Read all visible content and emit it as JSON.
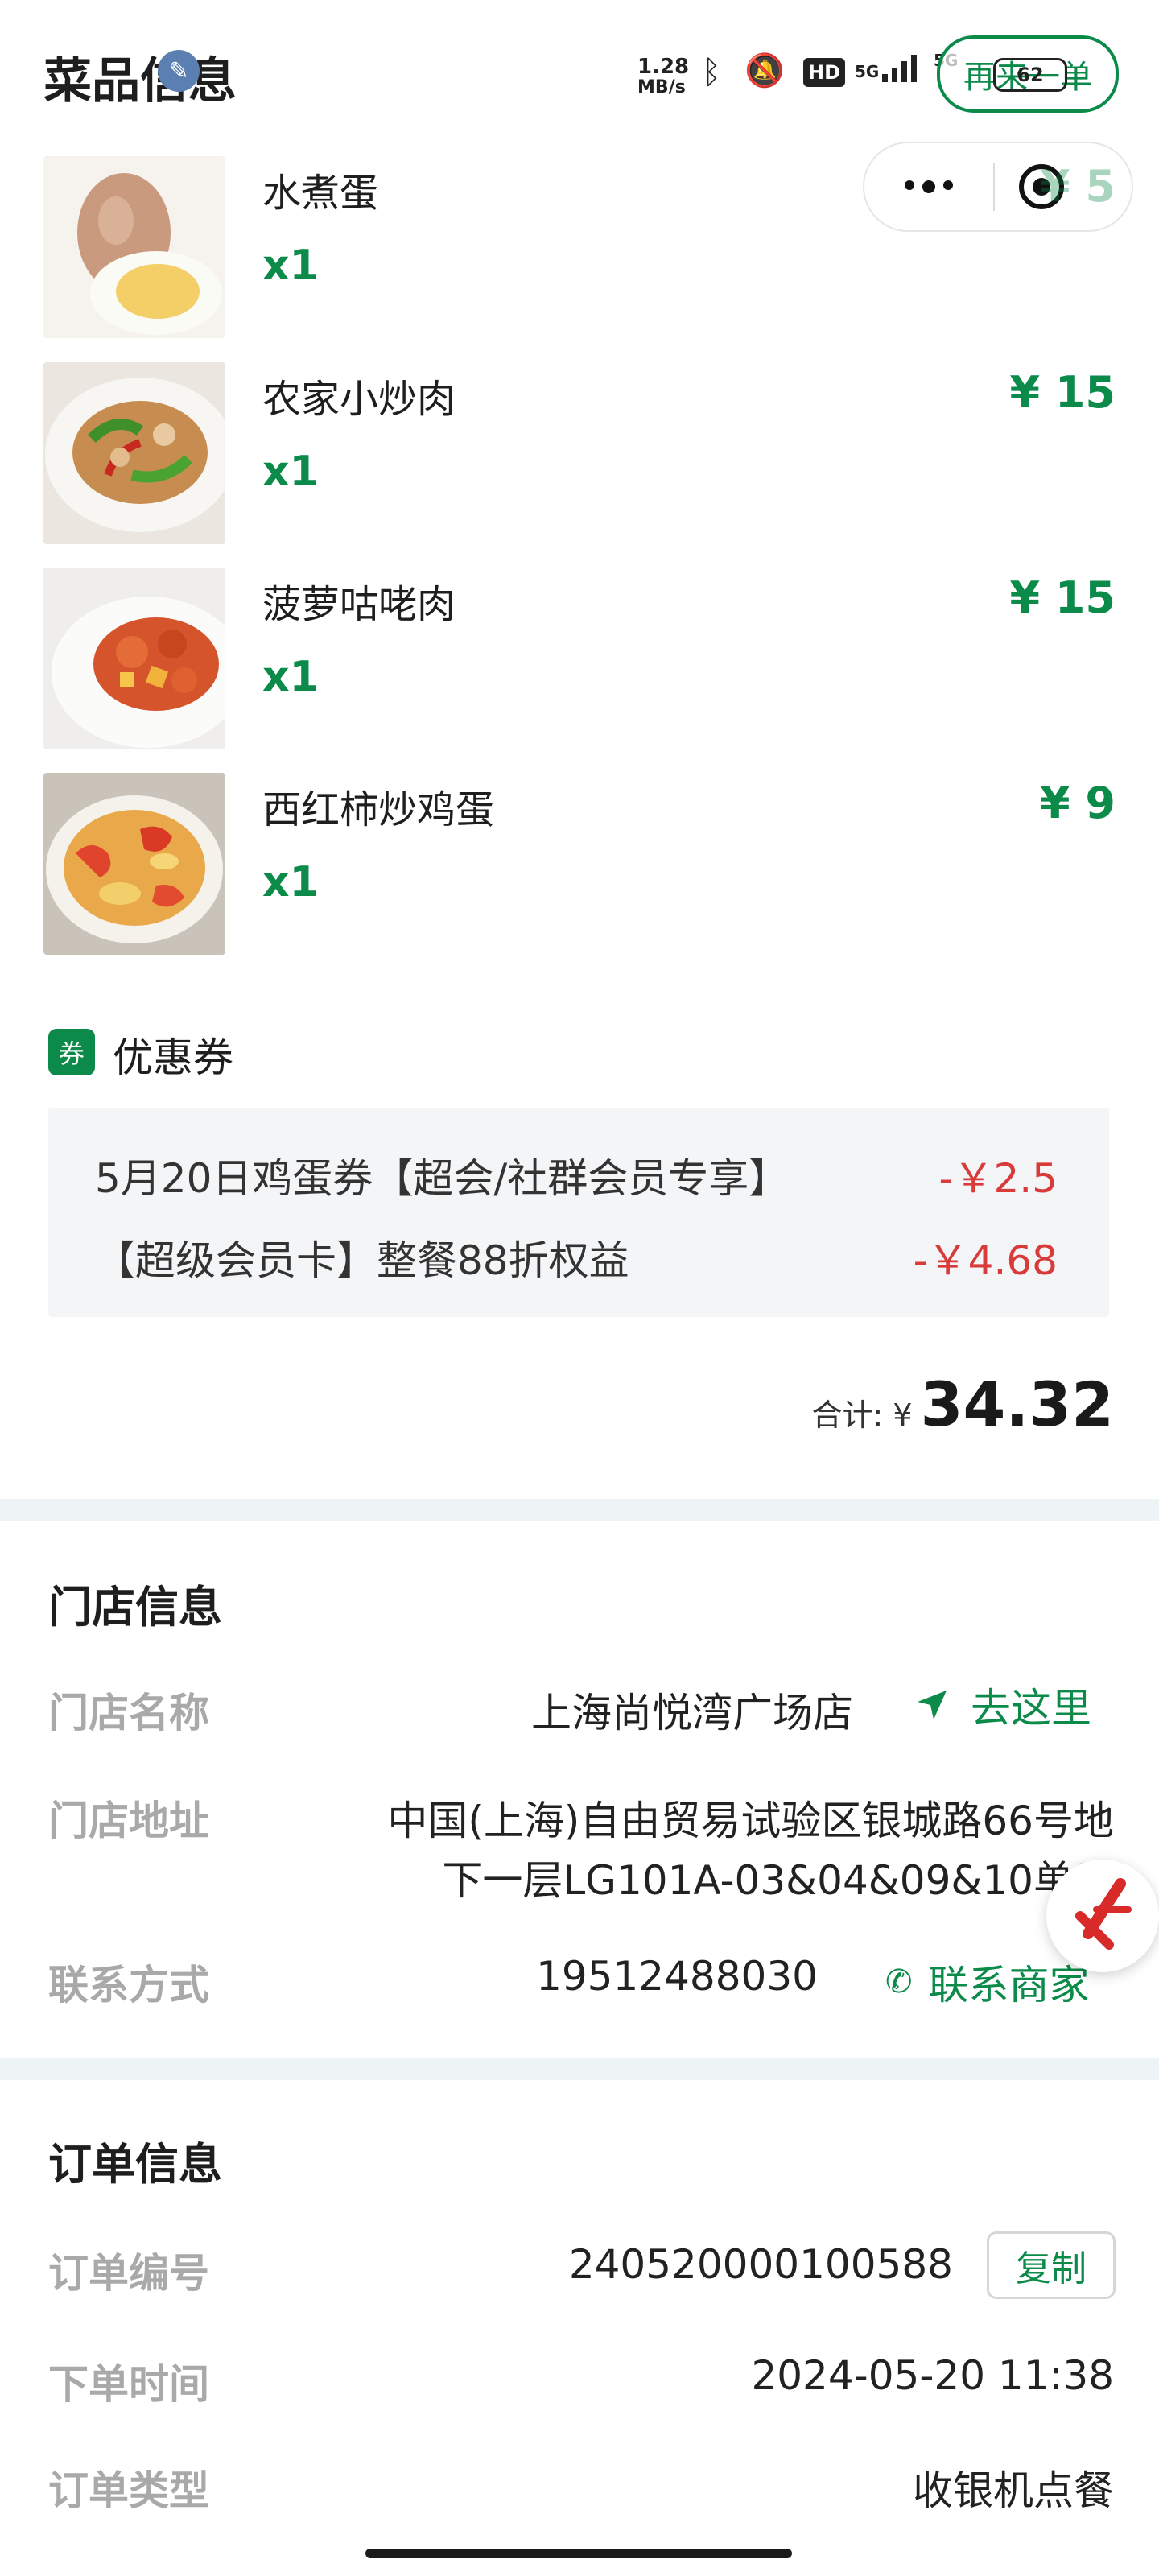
{
  "header": {
    "title": "菜品信息",
    "reorder_label": "再来一单"
  },
  "status_bar": {
    "speed_value": "1.28",
    "speed_unit": "MB/s",
    "network_1": "5G",
    "network_2": "5G",
    "battery": "62"
  },
  "dishes": [
    {
      "name": "水煮蛋",
      "qty": "x1",
      "price": "¥ 5"
    },
    {
      "name": "农家小炒肉",
      "qty": "x1",
      "price": "¥ 15"
    },
    {
      "name": "菠萝咕咾肉",
      "qty": "x1",
      "price": "¥ 15"
    },
    {
      "name": "西红柿炒鸡蛋",
      "qty": "x1",
      "price": "¥ 9"
    }
  ],
  "coupons": {
    "badge": "券",
    "title": "优惠券",
    "items": [
      {
        "name": "5月20日鸡蛋券【超会/社群会员专享】",
        "amount": "-￥2.5"
      },
      {
        "name": "【超级会员卡】整餐88折权益",
        "amount": "-￥4.68"
      }
    ]
  },
  "total": {
    "label": "合计: ¥",
    "value": "34.32"
  },
  "store": {
    "title": "门店信息",
    "name_label": "门店名称",
    "name_value": "上海尚悦湾广场店",
    "navigate_label": "去这里",
    "address_label": "门店地址",
    "address_line1": "中国(上海)自由贸易试验区银城路66号地",
    "address_line2": "下一层LG101A-03&04&09&10单元",
    "contact_label": "联系方式",
    "contact_value": "19512488030",
    "contact_merchant_label": "联系商家"
  },
  "order": {
    "title": "订单信息",
    "number_label": "订单编号",
    "number_value": "240520000100588",
    "copy_label": "复制",
    "time_label": "下单时间",
    "time_value": "2024-05-20 11:38",
    "type_label": "订单类型",
    "type_value": "收银机点餐"
  },
  "colors": {
    "accent_green": "#0b8a4a",
    "discount_red": "#d93a3a",
    "section_gap": "#eef4f5"
  }
}
